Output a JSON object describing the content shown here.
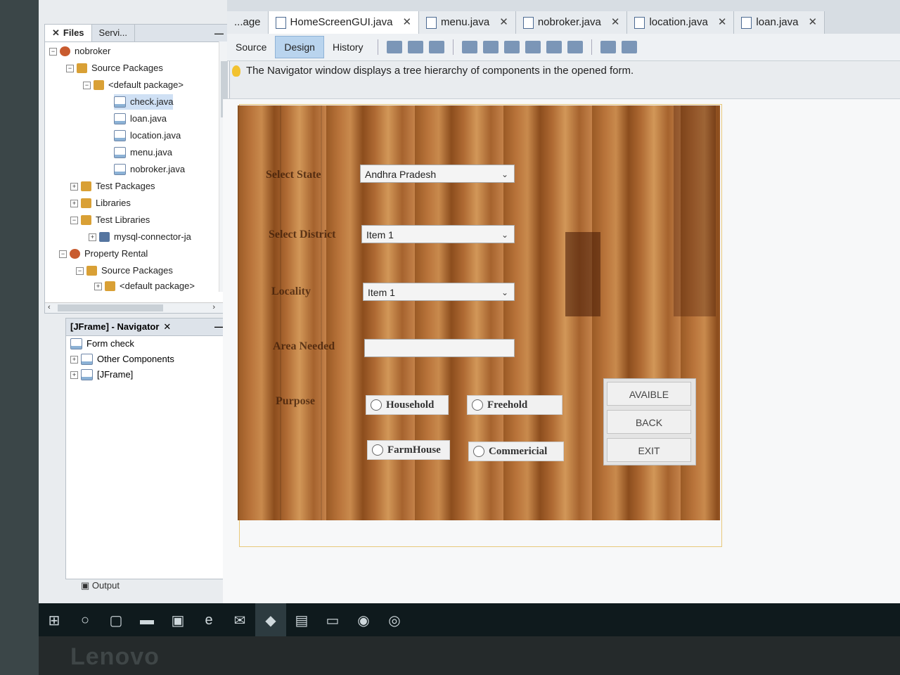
{
  "files_panel": {
    "tabs": [
      "Files",
      "Servi..."
    ],
    "tree": [
      {
        "label": "nobroker",
        "type": "project"
      },
      {
        "label": "Source Packages",
        "type": "package"
      },
      {
        "label": "<default package>",
        "type": "package"
      },
      {
        "label": "check.java",
        "type": "java"
      },
      {
        "label": "loan.java",
        "type": "java"
      },
      {
        "label": "location.java",
        "type": "java"
      },
      {
        "label": "menu.java",
        "type": "java"
      },
      {
        "label": "nobroker.java",
        "type": "java"
      },
      {
        "label": "Test Packages",
        "type": "package"
      },
      {
        "label": "Libraries",
        "type": "package"
      },
      {
        "label": "Test Libraries",
        "type": "package"
      },
      {
        "label": "mysql-connector-ja",
        "type": "jar"
      },
      {
        "label": "Property Rental",
        "type": "project"
      },
      {
        "label": "Source Packages",
        "type": "package"
      },
      {
        "label": "<default package>",
        "type": "package"
      }
    ]
  },
  "navigator": {
    "title": "[JFrame] - Navigator",
    "items": [
      "Form check",
      "Other Components",
      "[JFrame]"
    ]
  },
  "output_label": "Output",
  "editor": {
    "tabs": [
      "...age",
      "HomeScreenGUI.java",
      "menu.java",
      "nobroker.java",
      "location.java",
      "loan.java"
    ],
    "views": [
      "Source",
      "Design",
      "History"
    ],
    "active_view": "Design",
    "hint": "The Navigator window displays a tree hierarchy of components in the opened form."
  },
  "form": {
    "labels": {
      "state": "Select State",
      "district": "Select District",
      "locality": "Locality",
      "area": "Area Needed",
      "purpose": "Purpose"
    },
    "combos": {
      "state": "Andhra Pradesh",
      "district": "Item 1",
      "locality": "Item 1"
    },
    "radios": [
      "Household",
      "Freehold",
      "FarmHouse",
      "Commericial"
    ],
    "buttons": [
      "AVAIBLE",
      "BACK",
      "EXIT"
    ]
  },
  "brand": "Lenovo"
}
